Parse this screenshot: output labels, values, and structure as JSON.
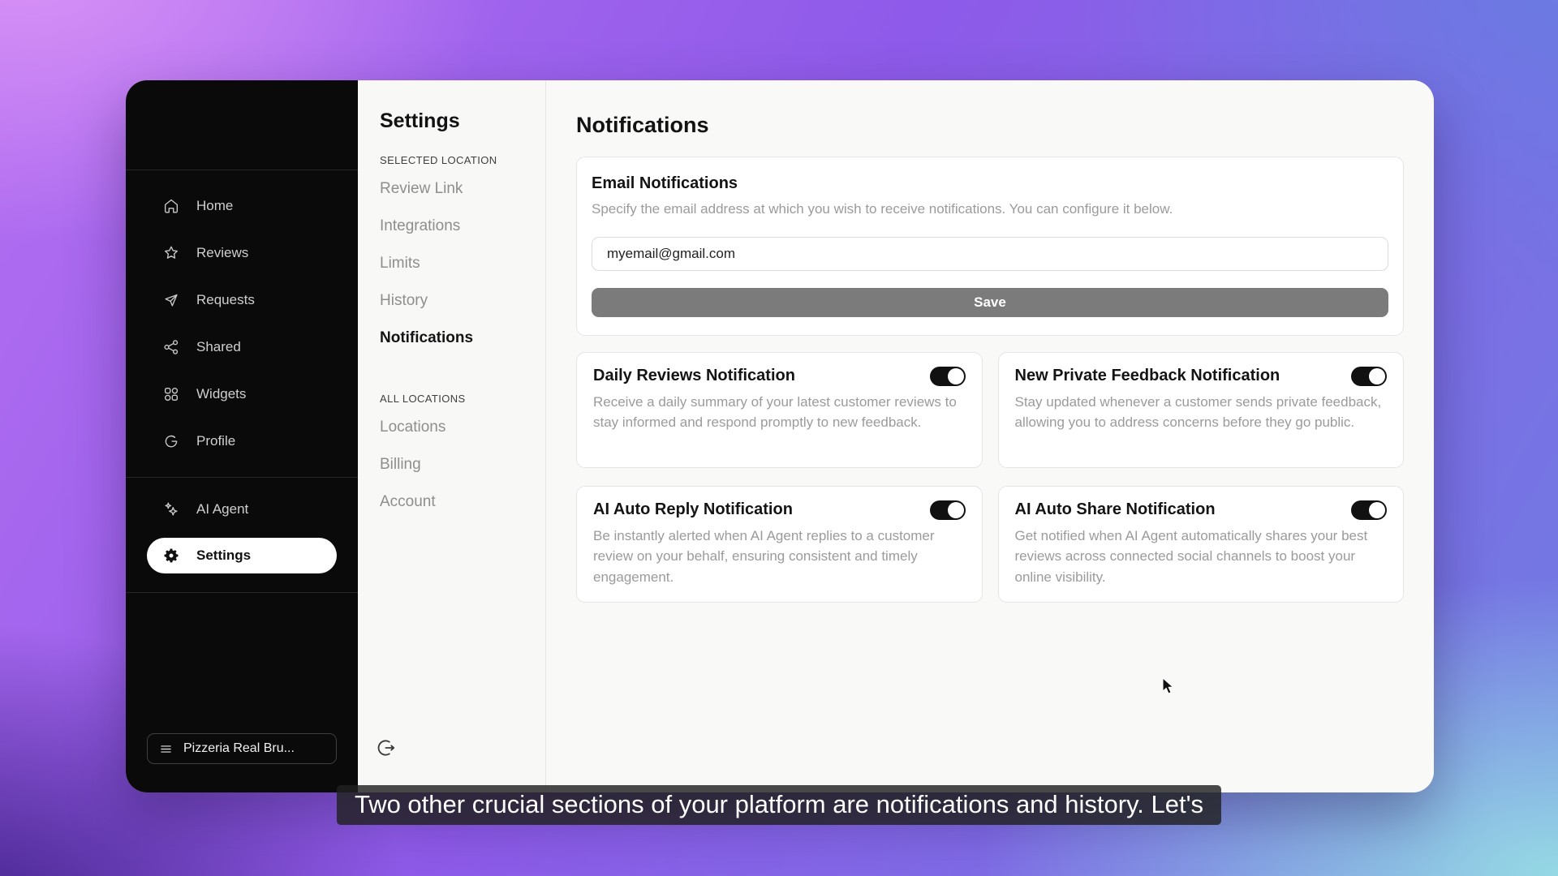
{
  "app": {
    "sidebar": {
      "items": [
        {
          "icon": "home-icon",
          "label": "Home"
        },
        {
          "icon": "star-icon",
          "label": "Reviews"
        },
        {
          "icon": "send-icon",
          "label": "Requests"
        },
        {
          "icon": "share-icon",
          "label": "Shared"
        },
        {
          "icon": "widgets-icon",
          "label": "Widgets"
        },
        {
          "icon": "g-profile-icon",
          "label": "Profile"
        }
      ],
      "secondary_items": [
        {
          "icon": "sparkles-icon",
          "label": "AI Agent",
          "active": false
        },
        {
          "icon": "gear-icon",
          "label": "Settings",
          "active": true
        }
      ],
      "location_button": {
        "icon": "hamburger-icon",
        "label": "Pizzeria Real Bru..."
      }
    },
    "subnav": {
      "title": "Settings",
      "sections": [
        {
          "label": "SELECTED LOCATION",
          "items": [
            "Review Link",
            "Integrations",
            "Limits",
            "History",
            "Notifications"
          ],
          "active_item": "Notifications"
        },
        {
          "label": "ALL LOCATIONS",
          "items": [
            "Locations",
            "Billing",
            "Account"
          ]
        }
      ],
      "logout_icon": "logout-icon"
    },
    "main": {
      "title": "Notifications",
      "email_card": {
        "title": "Email Notifications",
        "description": "Specify the email address at which you wish to receive notifications. You can configure it below.",
        "email_value": "myemail@gmail.com",
        "save_label": "Save"
      },
      "toggle_cards": [
        {
          "title": "Daily Reviews Notification",
          "description": "Receive a daily summary of your latest customer reviews to stay informed and respond promptly to new feedback.",
          "enabled": true
        },
        {
          "title": "New Private Feedback Notification",
          "description": "Stay updated whenever a customer sends private feedback, allowing you to address concerns before they go public.",
          "enabled": true
        },
        {
          "title": "AI Auto Reply Notification",
          "description": "Be instantly alerted when AI Agent replies to a customer review on your behalf, ensuring consistent and timely engagement.",
          "enabled": true
        },
        {
          "title": "AI Auto Share Notification",
          "description": "Get notified when AI Agent automatically shares your best reviews across connected social channels to boost your online visibility.",
          "enabled": true
        }
      ]
    }
  },
  "caption": "Two other crucial sections of your platform are notifications and history. Let's",
  "colors": {
    "sidebar_bg": "#0a0a0a",
    "active_pill_bg": "#ffffff",
    "save_button_bg": "#7b7b7b",
    "toggle_on_bg": "#111111",
    "gradient_top_left": "#d892f6",
    "gradient_top_right": "#687ce2",
    "gradient_bottom_left": "#34187c",
    "gradient_bottom_right": "#96d9e4"
  }
}
